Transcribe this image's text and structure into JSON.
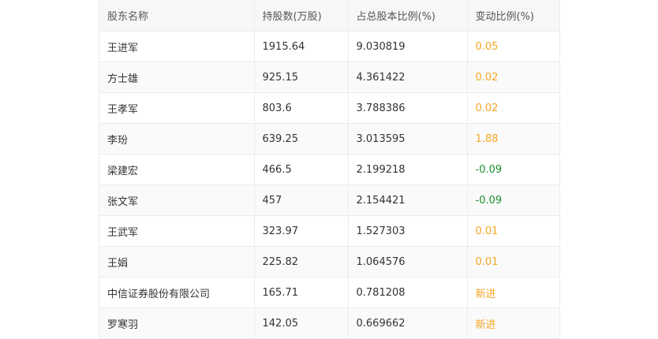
{
  "table": {
    "headers": [
      "股东名称",
      "持股数(万股)",
      "占总股本比例(%)",
      "变动比例(%)"
    ],
    "rows": [
      {
        "name": "王进军",
        "shares": "1915.64",
        "ratio": "9.030819",
        "change": "0.05",
        "trend": "up"
      },
      {
        "name": "方士雄",
        "shares": "925.15",
        "ratio": "4.361422",
        "change": "0.02",
        "trend": "up"
      },
      {
        "name": "王孝军",
        "shares": "803.6",
        "ratio": "3.788386",
        "change": "0.02",
        "trend": "up"
      },
      {
        "name": "李玢",
        "shares": "639.25",
        "ratio": "3.013595",
        "change": "1.88",
        "trend": "up"
      },
      {
        "name": "梁建宏",
        "shares": "466.5",
        "ratio": "2.199218",
        "change": "-0.09",
        "trend": "down"
      },
      {
        "name": "张文军",
        "shares": "457",
        "ratio": "2.154421",
        "change": "-0.09",
        "trend": "down"
      },
      {
        "name": "王武军",
        "shares": "323.97",
        "ratio": "1.527303",
        "change": "0.01",
        "trend": "up"
      },
      {
        "name": "王娟",
        "shares": "225.82",
        "ratio": "1.064576",
        "change": "0.01",
        "trend": "up"
      },
      {
        "name": "中信证券股份有限公司",
        "shares": "165.71",
        "ratio": "0.781208",
        "change": "新进",
        "trend": "new"
      },
      {
        "name": "罗寒羽",
        "shares": "142.05",
        "ratio": "0.669662",
        "change": "新进",
        "trend": "new"
      }
    ]
  },
  "colors": {
    "up": "#f5a623",
    "down": "#1a8f2e",
    "new": "#f5a623",
    "header_bg": "#f7f7f7",
    "border": "#ececec"
  }
}
